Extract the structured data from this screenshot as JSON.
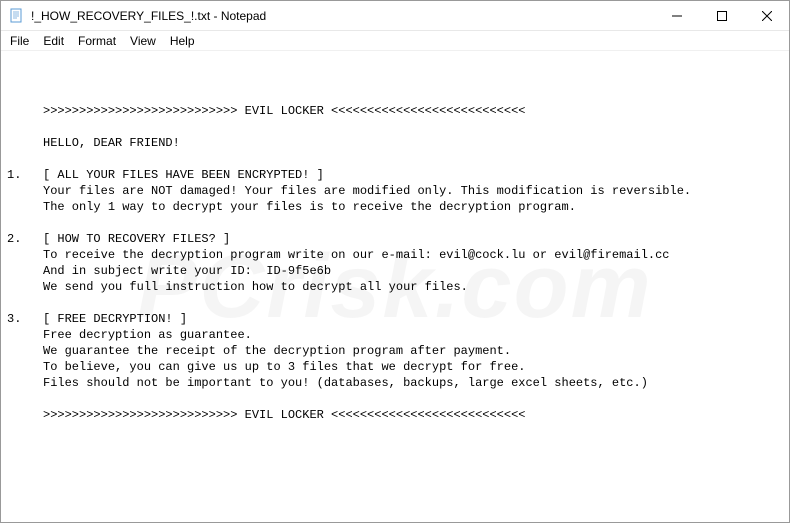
{
  "titlebar": {
    "title": "!_HOW_RECOVERY_FILES_!.txt - Notepad"
  },
  "menubar": {
    "file": "File",
    "edit": "Edit",
    "format": "Format",
    "view": "View",
    "help": "Help"
  },
  "content": {
    "text": "     >>>>>>>>>>>>>>>>>>>>>>>>>>> EVIL LOCKER <<<<<<<<<<<<<<<<<<<<<<<<<<<\n\n     HELLO, DEAR FRIEND!\n\n1.   [ ALL YOUR FILES HAVE BEEN ENCRYPTED! ]\n     Your files are NOT damaged! Your files are modified only. This modification is reversible.\n     The only 1 way to decrypt your files is to receive the decryption program.\n\n2.   [ HOW TO RECOVERY FILES? ]\n     To receive the decryption program write on our e-mail: evil@cock.lu or evil@firemail.cc\n     And in subject write your ID:  ID-9f5e6b\n     We send you full instruction how to decrypt all your files.\n\n3.   [ FREE DECRYPTION! ]\n     Free decryption as guarantee.\n     We guarantee the receipt of the decryption program after payment.\n     To believe, you can give us up to 3 files that we decrypt for free.\n     Files should not be important to you! (databases, backups, large excel sheets, etc.)\n\n     >>>>>>>>>>>>>>>>>>>>>>>>>>> EVIL LOCKER <<<<<<<<<<<<<<<<<<<<<<<<<<<"
  },
  "watermark": {
    "text": "PCrisk.com"
  }
}
